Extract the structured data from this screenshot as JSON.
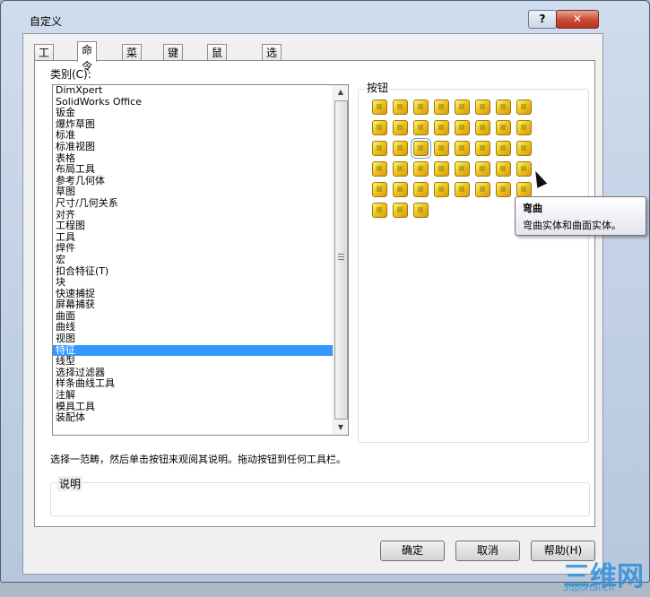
{
  "window": {
    "title": "自定义",
    "help_label": "?",
    "close_label": "✕"
  },
  "tabs": [
    "工具栏",
    "命令",
    "菜单",
    "键盘",
    "鼠标笔势",
    "选项"
  ],
  "active_tab": 1,
  "categories": {
    "label": "类别(C):",
    "items": [
      "DimXpert",
      "SolidWorks Office",
      "钣金",
      "爆炸草图",
      "标准",
      "标准视图",
      "表格",
      "布局工具",
      "参考几何体",
      "草图",
      "尺寸/几何关系",
      "对齐",
      "工程图",
      "工具",
      "焊件",
      "宏",
      "扣合特征(T)",
      "块",
      "快速捕捉",
      "屏幕捕获",
      "曲面",
      "曲线",
      "视图",
      "特征",
      "线型",
      "选择过滤器",
      "样条曲线工具",
      "注解",
      "模具工具",
      "装配体"
    ],
    "selected_index": 23
  },
  "buttons_group": {
    "title": "按钮",
    "icon_names": [
      "extruded-boss-icon",
      "revolved-boss-icon",
      "swept-boss-icon",
      "lofted-boss-icon",
      "boundary-boss-icon",
      "extruded-cut-icon",
      "hole-wizard-icon",
      "revolved-cut-icon",
      "swept-cut-icon",
      "lofted-cut-icon",
      "fillet-icon",
      "chamfer-icon",
      "rib-icon",
      "draft-icon",
      "shell-icon",
      "wrap-icon",
      "dome-icon",
      "flex-icon",
      "scale-icon",
      "linear-pattern-icon",
      "circular-pattern-icon",
      "mirror-icon",
      "curve-pattern-icon",
      "sketch-pattern-icon",
      "table-pattern-icon",
      "fill-pattern-icon",
      "deform-icon",
      "indent-icon",
      "freeform-icon",
      "split-icon",
      "combine-icon",
      "intersect-icon",
      "move-copy-icon",
      "delete-body-icon",
      "thicken-icon",
      "cavity-icon",
      "joint-icon",
      "flex-bend-icon",
      "variable-pattern-icon",
      "move-face-icon",
      "delete-face-icon",
      "replace-face-icon",
      "check-list-icon"
    ],
    "highlighted_index": 18
  },
  "tooltip": {
    "title": "弯曲",
    "body": "弯曲实体和曲面实体。"
  },
  "instruction": "选择一范畴，然后单击按钮来观阅其说明。拖动按钮到任何工具栏。",
  "description_group": {
    "title": "说明"
  },
  "footer": {
    "ok_label": "确定",
    "cancel_label": "取消",
    "help_label": "帮助(H)"
  },
  "watermark": {
    "main": "三维网",
    "sub": "3dportal.cn"
  }
}
